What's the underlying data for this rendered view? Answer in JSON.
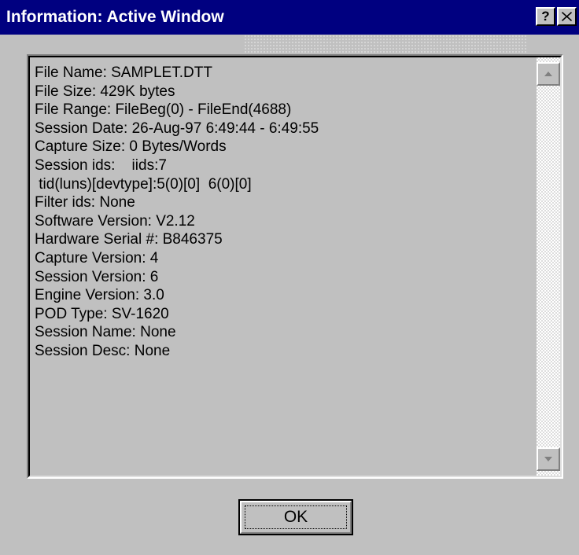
{
  "window": {
    "title": "Information: Active Window",
    "help_label": "?",
    "close_icon": "close-icon"
  },
  "info": {
    "lines": [
      "File Name: SAMPLET.DTT",
      "File Size: 429K bytes",
      "File Range: FileBeg(0) - FileEnd(4688)",
      "Session Date: 26-Aug-97 6:49:44 - 6:49:55",
      "Capture Size: 0 Bytes/Words",
      "Session ids:    iids:7",
      " tid(luns)[devtype]:5(0)[0]  6(0)[0]",
      "Filter ids: None",
      "Software Version: V2.12",
      "Hardware Serial #: B846375",
      "Capture Version: 4",
      "Session Version: 6",
      "Engine Version: 3.0",
      "POD Type: SV-1620",
      "Session Name: None",
      "Session Desc: None"
    ]
  },
  "buttons": {
    "ok_label": "OK"
  },
  "colors": {
    "titlebar": "#000080",
    "face": "#c0c0c0"
  }
}
